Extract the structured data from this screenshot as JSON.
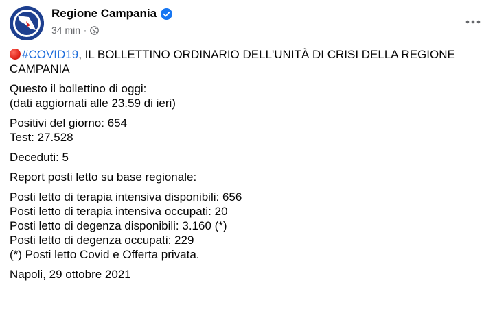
{
  "post": {
    "author": "Regione Campania",
    "time": "34 min",
    "separator": "·",
    "hashtag": "#COVID19",
    "headline_rest": ", IL BOLLETTINO ORDINARIO DELL'UNITÀ DI CRISI DELLA REGIONE CAMPANIA",
    "lines": {
      "intro1": "Questo il bollettino di oggi:",
      "intro2": "(dati aggiornati alle 23.59 di ieri)",
      "positivi": "Positivi del giorno: 654",
      "test": "Test: 27.528",
      "deceduti": "Deceduti: 5",
      "report": "Report posti letto su base regionale:",
      "ti_disp": "Posti letto di terapia intensiva disponibili: 656",
      "ti_occ": "Posti letto di terapia intensiva occupati: 20",
      "deg_disp": "Posti letto di degenza disponibili: 3.160 (*)",
      "deg_occ": "Posti letto di degenza occupati: 229",
      "note": "(*) Posti letto Covid e Offerta privata.",
      "date": "Napoli, 29 ottobre 2021"
    }
  },
  "icons": {
    "verified": "verified-badge-icon",
    "audience": "globe-icon",
    "more": "more-options-icon",
    "emoji": "red-circle-icon"
  },
  "colors": {
    "hashtag": "#216fdb",
    "verified": "#1877f2",
    "meta": "#65676b",
    "avatar_bg": "#1d3f8f"
  }
}
